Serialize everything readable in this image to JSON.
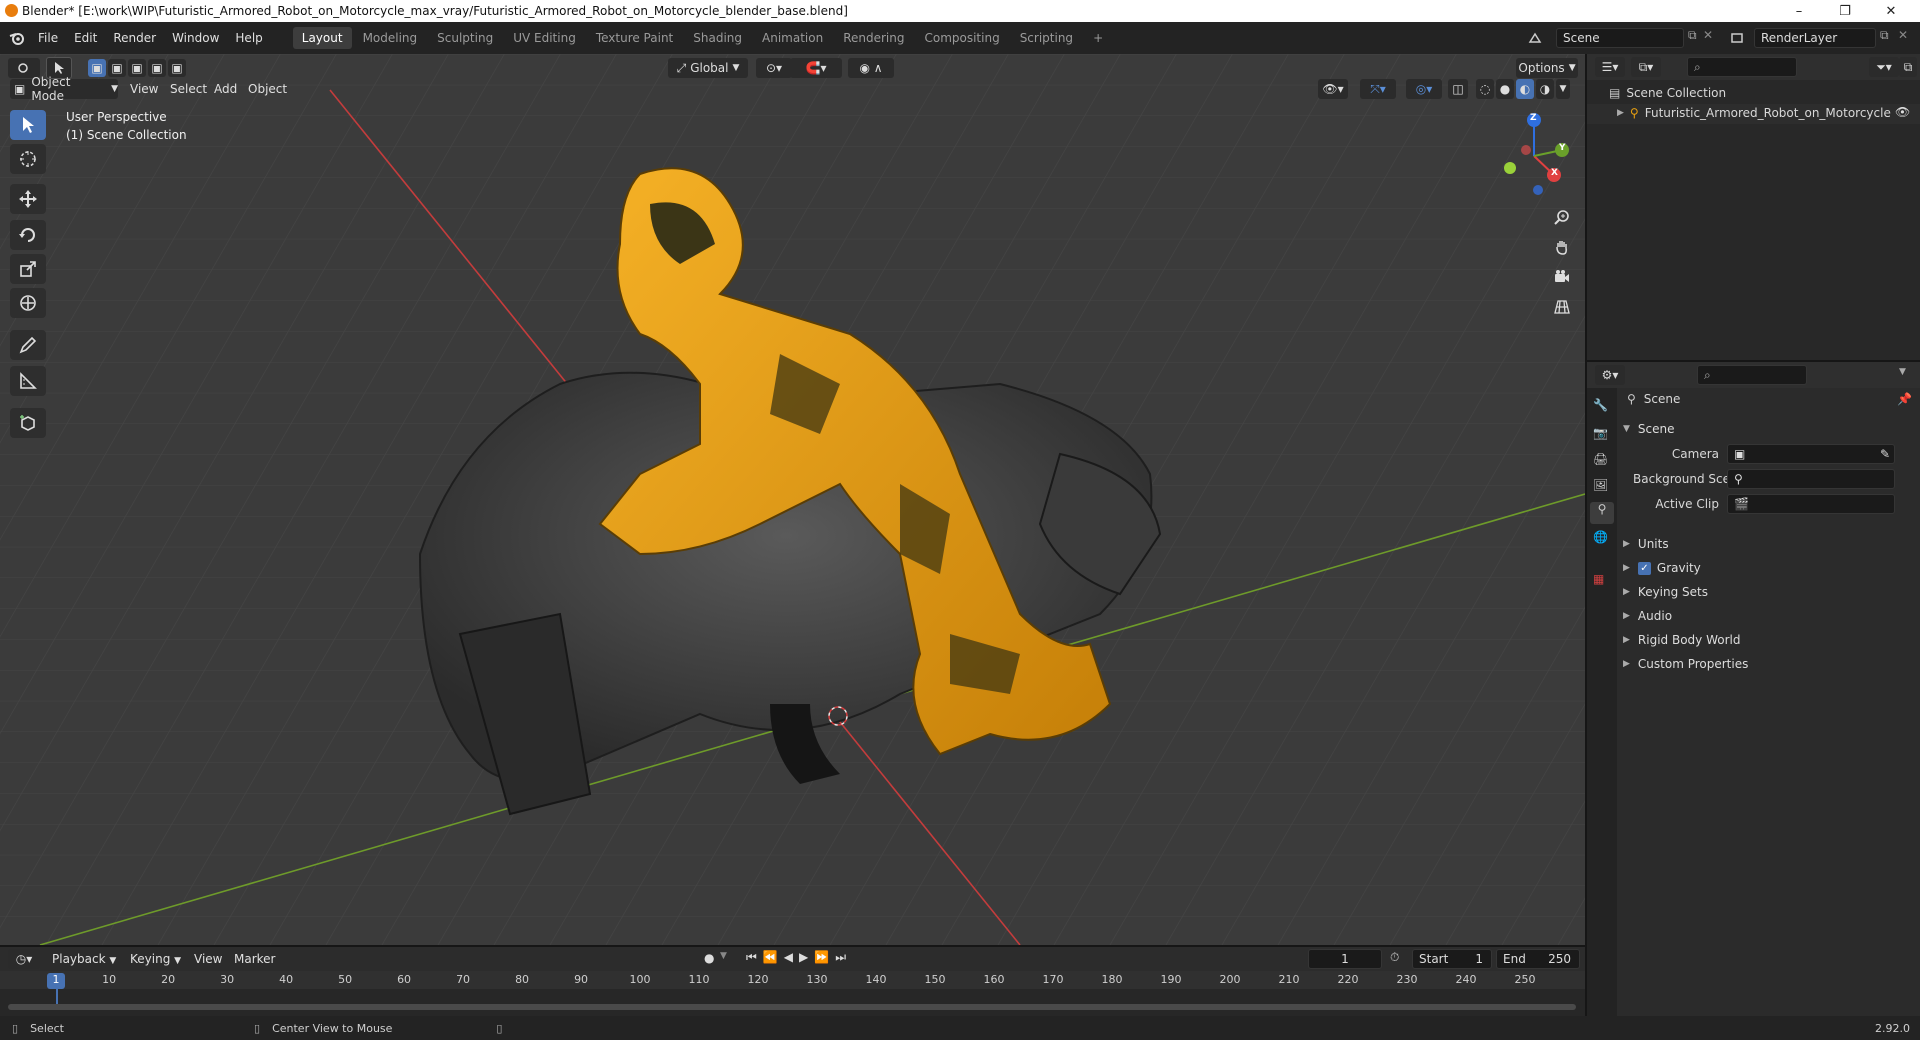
{
  "window": {
    "title": "Blender* [E:\\work\\WIP\\Futuristic_Armored_Robot_on_Motorcycle_max_vray/Futuristic_Armored_Robot_on_Motorcycle_blender_base.blend]",
    "minimize": "–",
    "maximize": "❐",
    "close": "✕"
  },
  "menu": [
    "File",
    "Edit",
    "Render",
    "Window",
    "Help"
  ],
  "workspaces": [
    "Layout",
    "Modeling",
    "Sculpting",
    "UV Editing",
    "Texture Paint",
    "Shading",
    "Animation",
    "Rendering",
    "Compositing",
    "Scripting"
  ],
  "workspace_add": "+",
  "scene_field": "Scene",
  "renderlayer_field": "RenderLayer",
  "viewport": {
    "mode": "Object Mode",
    "menus": [
      "View",
      "Select",
      "Add",
      "Object"
    ],
    "orientation": "Global",
    "options": "Options",
    "overlay_line1": "User Perspective",
    "overlay_line2": "(1) Scene Collection",
    "gizmo": {
      "x": "X",
      "y": "Y",
      "z": "Z"
    }
  },
  "outliner": {
    "root": "Scene Collection",
    "items": [
      "Futuristic_Armored_Robot_on_Motorcycle"
    ]
  },
  "properties": {
    "context": "Scene",
    "section": "Scene",
    "rows": [
      {
        "label": "Camera"
      },
      {
        "label": "Background Scene"
      },
      {
        "label": "Active Clip"
      }
    ],
    "panels": [
      "Units",
      "Gravity",
      "Keying Sets",
      "Audio",
      "Rigid Body World",
      "Custom Properties"
    ],
    "gravity_checked": true
  },
  "timeline": {
    "menus": [
      "Playback",
      "Keying",
      "View",
      "Marker"
    ],
    "current_frame": "1",
    "start_label": "Start",
    "start": "1",
    "end_label": "End",
    "end": "250",
    "ticks": [
      "1",
      "10",
      "20",
      "30",
      "40",
      "50",
      "60",
      "70",
      "80",
      "90",
      "100",
      "110",
      "120",
      "130",
      "140",
      "150",
      "160",
      "170",
      "180",
      "190",
      "200",
      "210",
      "220",
      "230",
      "240",
      "250"
    ]
  },
  "status": {
    "left": "Select",
    "middle": "Center View to Mouse",
    "version": "2.92.0"
  },
  "colors": {
    "accent": "#4772b3",
    "robot": "#e8a010",
    "x_axis": "#c33c3c",
    "y_axis": "#6e9b2a"
  }
}
